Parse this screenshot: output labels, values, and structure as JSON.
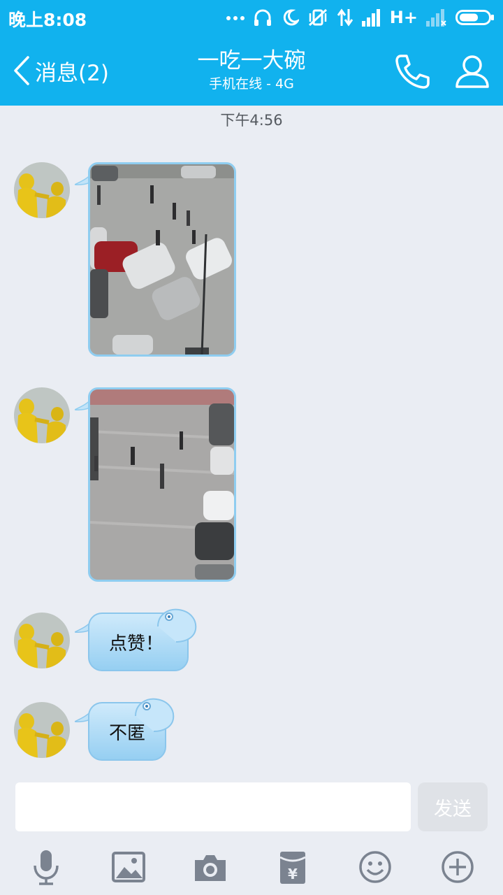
{
  "status_bar": {
    "time": "晚上8:08",
    "network_label": "H+",
    "icons": [
      "more-dots-icon",
      "headphones-icon",
      "moon-icon",
      "vibrate-off-icon",
      "data-arrows-icon",
      "signal-icon",
      "signal-weak-icon",
      "battery-icon"
    ]
  },
  "header": {
    "back_label": "消息(2)",
    "title": "一吃一大碗",
    "subtitle": "手机在线 - 4G",
    "phone_icon": "phone-icon",
    "profile_icon": "profile-icon"
  },
  "chat": {
    "timestamp": "下午4:56",
    "messages": [
      {
        "type": "image",
        "content": "parking-lot-photo"
      },
      {
        "type": "image",
        "content": "plaza-photo"
      },
      {
        "type": "text",
        "text": "点赞！"
      },
      {
        "type": "text",
        "text": "不匿"
      }
    ]
  },
  "composer": {
    "input_value": "",
    "send_label": "发送"
  },
  "toolbar": {
    "items": [
      "microphone-icon",
      "image-icon",
      "camera-icon",
      "red-packet-icon",
      "emoji-icon",
      "plus-icon"
    ]
  },
  "colors": {
    "header_bg": "#11b2ee",
    "chat_bg": "#eaedf3",
    "bubble_light": "#cfeafb",
    "bubble_dark": "#96cff2"
  }
}
